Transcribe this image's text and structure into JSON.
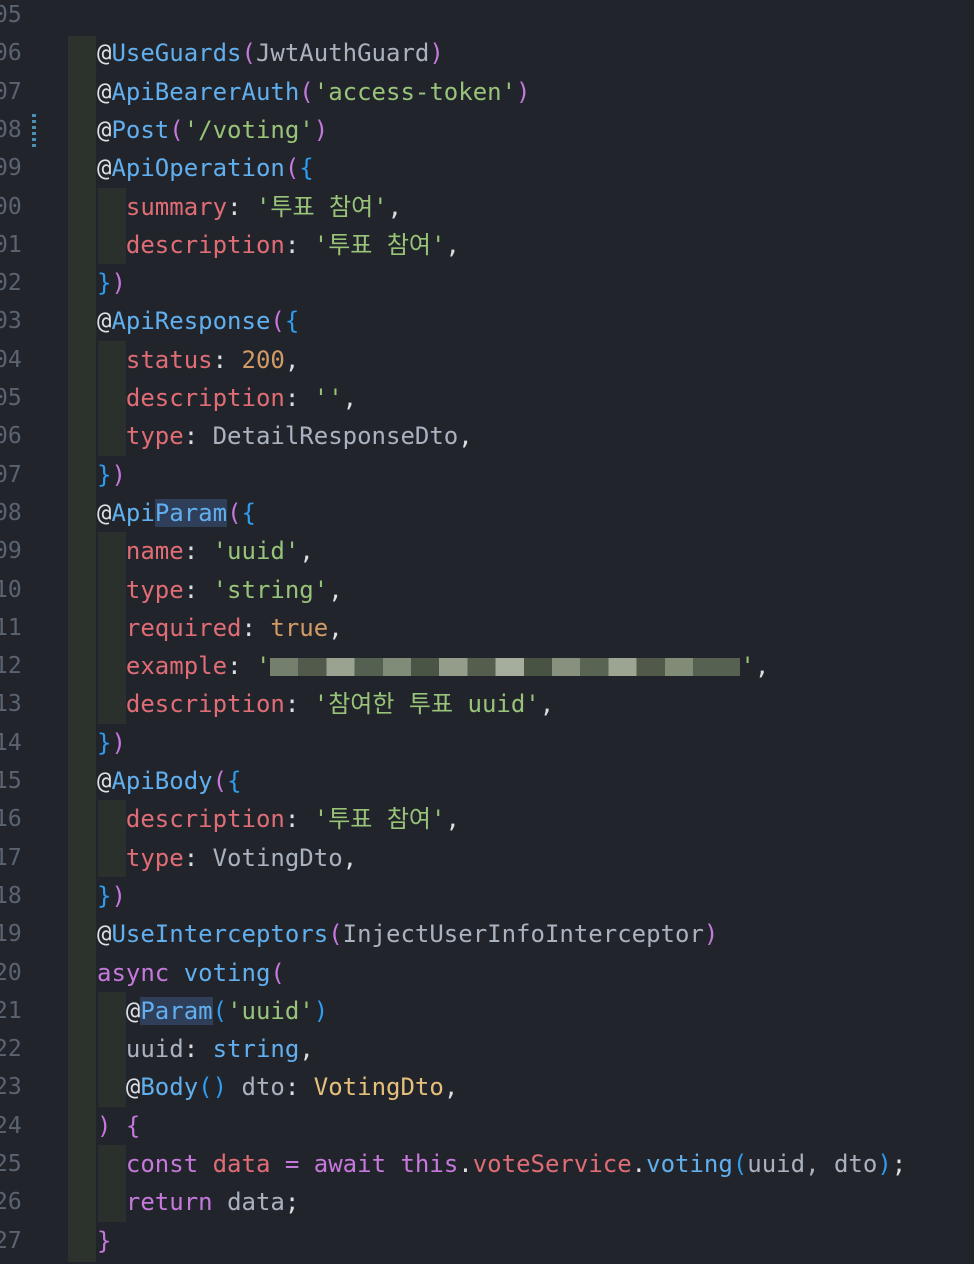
{
  "editor": {
    "line_numbers": [
      "05",
      "06",
      "07",
      "08",
      "09",
      "00",
      "01",
      "02",
      "03",
      "04",
      "05",
      "06",
      "07",
      "08",
      "09",
      "10",
      "11",
      "12",
      "13",
      "14",
      "15",
      "16",
      "17",
      "18",
      "19",
      "20",
      "21",
      "22",
      "23",
      "24",
      "25",
      "26",
      "27"
    ],
    "lines": [
      [],
      [
        [
          "dec",
          "@"
        ],
        [
          "fn",
          "UseGuards"
        ],
        [
          "paren",
          "("
        ],
        [
          "plain",
          "JwtAuthGuard"
        ],
        [
          "paren",
          ")"
        ]
      ],
      [
        [
          "dec",
          "@"
        ],
        [
          "fn",
          "ApiBearerAuth"
        ],
        [
          "paren",
          "("
        ],
        [
          "str",
          "'access-token'"
        ],
        [
          "paren",
          ")"
        ]
      ],
      [
        [
          "dec",
          "@"
        ],
        [
          "fn",
          "Post"
        ],
        [
          "paren",
          "("
        ],
        [
          "str",
          "'/voting'"
        ],
        [
          "paren",
          ")"
        ]
      ],
      [
        [
          "dec",
          "@"
        ],
        [
          "fn",
          "ApiOperation"
        ],
        [
          "paren",
          "("
        ],
        [
          "brace",
          "{"
        ]
      ],
      [
        [
          "plain",
          "  "
        ],
        [
          "key",
          "summary"
        ],
        [
          "punct",
          ": "
        ],
        [
          "str",
          "'투표 참여'"
        ],
        [
          "punct",
          ","
        ]
      ],
      [
        [
          "plain",
          "  "
        ],
        [
          "key",
          "description"
        ],
        [
          "punct",
          ": "
        ],
        [
          "str",
          "'투표 참여'"
        ],
        [
          "punct",
          ","
        ]
      ],
      [
        [
          "brace",
          "}"
        ],
        [
          "paren",
          ")"
        ]
      ],
      [
        [
          "dec",
          "@"
        ],
        [
          "fn",
          "ApiResponse"
        ],
        [
          "paren",
          "("
        ],
        [
          "brace",
          "{"
        ]
      ],
      [
        [
          "plain",
          "  "
        ],
        [
          "key",
          "status"
        ],
        [
          "punct",
          ": "
        ],
        [
          "num",
          "200"
        ],
        [
          "punct",
          ","
        ]
      ],
      [
        [
          "plain",
          "  "
        ],
        [
          "key",
          "description"
        ],
        [
          "punct",
          ": "
        ],
        [
          "str",
          "''"
        ],
        [
          "punct",
          ","
        ]
      ],
      [
        [
          "plain",
          "  "
        ],
        [
          "key",
          "type"
        ],
        [
          "punct",
          ": "
        ],
        [
          "plain",
          "DetailResponseDto"
        ],
        [
          "punct",
          ","
        ]
      ],
      [
        [
          "brace",
          "}"
        ],
        [
          "paren",
          ")"
        ]
      ],
      [
        [
          "dec",
          "@"
        ],
        [
          "fn",
          "Api"
        ],
        [
          "fnhl",
          "Param"
        ],
        [
          "paren",
          "("
        ],
        [
          "brace",
          "{"
        ]
      ],
      [
        [
          "plain",
          "  "
        ],
        [
          "key",
          "name"
        ],
        [
          "punct",
          ": "
        ],
        [
          "str",
          "'uuid'"
        ],
        [
          "punct",
          ","
        ]
      ],
      [
        [
          "plain",
          "  "
        ],
        [
          "key",
          "type"
        ],
        [
          "punct",
          ": "
        ],
        [
          "str",
          "'string'"
        ],
        [
          "punct",
          ","
        ]
      ],
      [
        [
          "plain",
          "  "
        ],
        [
          "key",
          "required"
        ],
        [
          "punct",
          ": "
        ],
        [
          "bool",
          "true"
        ],
        [
          "punct",
          ","
        ]
      ],
      [
        [
          "plain",
          "  "
        ],
        [
          "key",
          "example"
        ],
        [
          "punct",
          ": "
        ],
        [
          "str",
          "'"
        ],
        [
          "blur",
          ""
        ],
        [
          "str",
          "'"
        ],
        [
          "punct",
          ","
        ]
      ],
      [
        [
          "plain",
          "  "
        ],
        [
          "key",
          "description"
        ],
        [
          "punct",
          ": "
        ],
        [
          "str",
          "'참여한 투표 uuid'"
        ],
        [
          "punct",
          ","
        ]
      ],
      [
        [
          "brace",
          "}"
        ],
        [
          "paren",
          ")"
        ]
      ],
      [
        [
          "dec",
          "@"
        ],
        [
          "fn",
          "ApiBody"
        ],
        [
          "paren",
          "("
        ],
        [
          "brace",
          "{"
        ]
      ],
      [
        [
          "plain",
          "  "
        ],
        [
          "key",
          "description"
        ],
        [
          "punct",
          ": "
        ],
        [
          "str",
          "'투표 참여'"
        ],
        [
          "punct",
          ","
        ]
      ],
      [
        [
          "plain",
          "  "
        ],
        [
          "key",
          "type"
        ],
        [
          "punct",
          ": "
        ],
        [
          "plain",
          "VotingDto"
        ],
        [
          "punct",
          ","
        ]
      ],
      [
        [
          "brace",
          "}"
        ],
        [
          "paren",
          ")"
        ]
      ],
      [
        [
          "dec",
          "@"
        ],
        [
          "fn",
          "UseInterceptors"
        ],
        [
          "paren",
          "("
        ],
        [
          "plain",
          "InjectUserInfoInterceptor"
        ],
        [
          "paren",
          ")"
        ]
      ],
      [
        [
          "kw",
          "async "
        ],
        [
          "fn",
          "voting"
        ],
        [
          "paren",
          "("
        ]
      ],
      [
        [
          "plain",
          "  "
        ],
        [
          "dec",
          "@"
        ],
        [
          "fnhl",
          "Param"
        ],
        [
          "brace",
          "("
        ],
        [
          "str",
          "'uuid'"
        ],
        [
          "brace",
          ")"
        ]
      ],
      [
        [
          "plain",
          "  uuid"
        ],
        [
          "punct",
          ": "
        ],
        [
          "fn",
          "string"
        ],
        [
          "punct",
          ","
        ]
      ],
      [
        [
          "plain",
          "  "
        ],
        [
          "dec",
          "@"
        ],
        [
          "fn",
          "Body"
        ],
        [
          "brace",
          "()"
        ],
        [
          "plain",
          " dto"
        ],
        [
          "punct",
          ": "
        ],
        [
          "type",
          "VotingDto"
        ],
        [
          "punct",
          ","
        ]
      ],
      [
        [
          "paren",
          ")"
        ],
        [
          "plain",
          " "
        ],
        [
          "paren",
          "{"
        ]
      ],
      [
        [
          "plain",
          "  "
        ],
        [
          "kw",
          "const "
        ],
        [
          "key",
          "data"
        ],
        [
          "plain",
          " "
        ],
        [
          "paren",
          "= "
        ],
        [
          "kw",
          "await "
        ],
        [
          "kw",
          "this"
        ],
        [
          "punct",
          "."
        ],
        [
          "key",
          "voteService"
        ],
        [
          "punct",
          "."
        ],
        [
          "fn",
          "voting"
        ],
        [
          "brace",
          "("
        ],
        [
          "plain",
          "uuid, dto"
        ],
        [
          "brace",
          ")"
        ],
        [
          "punct",
          ";"
        ]
      ],
      [
        [
          "plain",
          "  "
        ],
        [
          "kw",
          "return "
        ],
        [
          "plain",
          "data"
        ],
        [
          "punct",
          ";"
        ]
      ],
      [
        [
          "paren",
          "}"
        ]
      ]
    ]
  }
}
